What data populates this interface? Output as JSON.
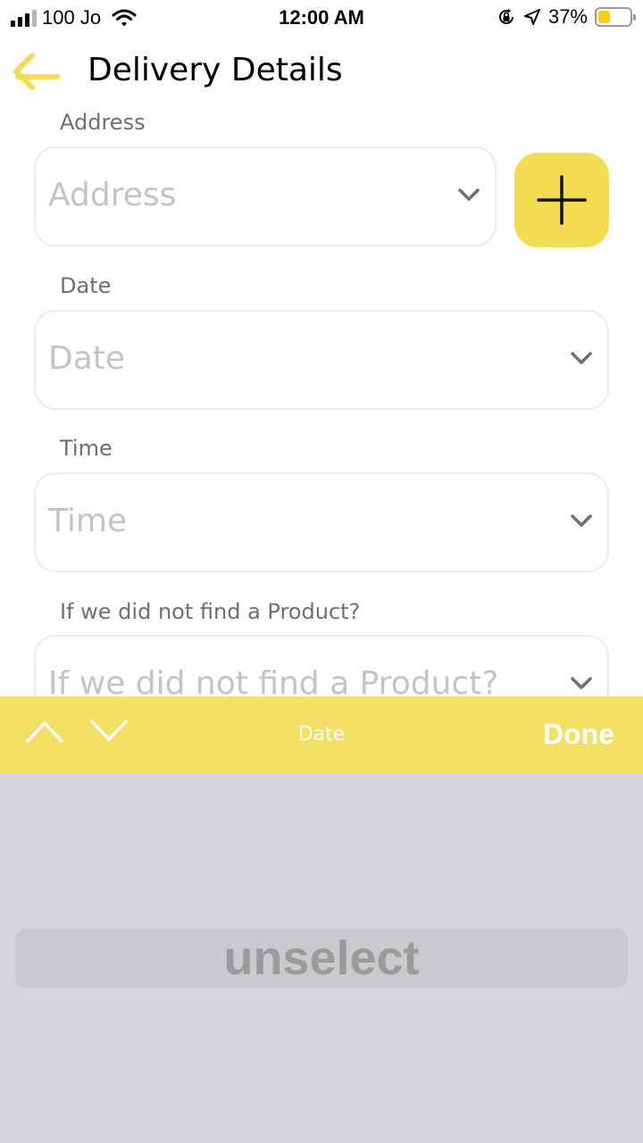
{
  "status_bar": {
    "carrier": "100 Jo",
    "time": "12:00 AM",
    "battery_percent": "37%",
    "battery_level": 0.37,
    "icons": [
      "signal-icon",
      "wifi-icon",
      "orientation-lock-icon",
      "location-arrow-icon",
      "battery-icon"
    ]
  },
  "header": {
    "title": "Delivery Details",
    "back_icon": "arrow-left-icon"
  },
  "form": {
    "address": {
      "label": "Address",
      "placeholder": "Address"
    },
    "date": {
      "label": "Date",
      "placeholder": "Date"
    },
    "time": {
      "label": "Time",
      "placeholder": "Time"
    },
    "not_found": {
      "label": "If we did not find a Product?",
      "placeholder": "If we did not find a Product?"
    }
  },
  "accessory_bar": {
    "title": "Date",
    "done_label": "Done"
  },
  "picker": {
    "selected": "unselect"
  },
  "colors": {
    "accent": "#F4DC51",
    "accessory_bar": "#F3DF64",
    "picker_bg": "#D3D5D9",
    "label_gray": "#6F6F6F",
    "placeholder_gray": "#C4C4C4"
  }
}
